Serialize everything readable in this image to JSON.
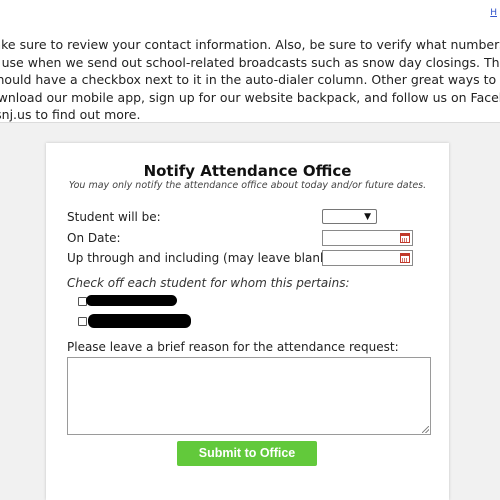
{
  "top": {
    "link_fragment": "H"
  },
  "notice": {
    "lines": [
      "lake sure to review your contact information. Also, be sure to verify what numbers you w",
      "o use when we send out school-related broadcasts such as snow day closings. The numbe",
      "should have a checkbox next to it in the auto-dialer column. Other great ways to stay info",
      "ownload our mobile app, sign up for our website backpack, and follow us on Facebook.  V",
      "rsnj.us to find out more."
    ]
  },
  "form": {
    "title": "Notify Attendance Office",
    "subtitle": "You may only notify the attendance office about today and/or future dates.",
    "student_will_be_label": "Student will be:",
    "student_will_be_value": "",
    "on_date_label": "On Date:",
    "on_date_value": "",
    "through_label": "Up through and including (may leave blank):",
    "through_value": "",
    "check_heading": "Check off each student for whom this pertains:",
    "reason_label": "Please leave a brief reason for the attendance request:",
    "reason_value": "",
    "submit_label": "Submit to Office"
  },
  "colors": {
    "submit": "#62c93b",
    "calendar_icon": "#c0392b"
  },
  "icons": [
    "calendar-icon",
    "chevron-down-icon",
    "resize-grip-icon"
  ]
}
